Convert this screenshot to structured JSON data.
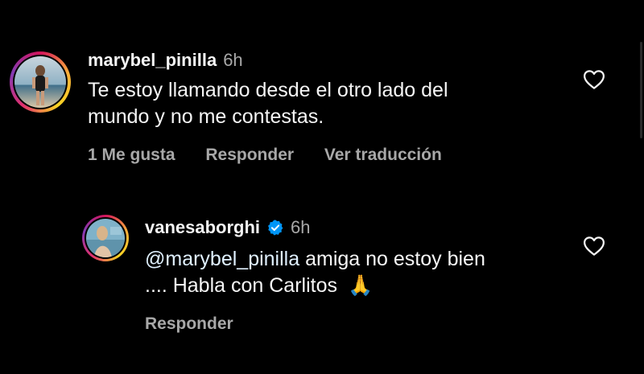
{
  "comments": [
    {
      "username": "marybel_pinilla",
      "time": "6h",
      "text_line1": "Te estoy llamando desde el otro lado del",
      "text_line2": "mundo y no me contestas.",
      "likes": "1 Me gusta",
      "reply": "Responder",
      "translate": "Ver traducción"
    },
    {
      "username": "vanesaborghi",
      "verified": true,
      "time": "6h",
      "mention": "@marybel_pinilla",
      "text_line1_rest": " amiga no estoy bien",
      "text_line2": ".... Habla con Carlitos",
      "emoji": "🙏",
      "reply": "Responder"
    }
  ],
  "colors": {
    "background": "#000000",
    "text": "#f5f5f5",
    "secondary": "#a8a8a8",
    "verified": "#0095f6"
  }
}
